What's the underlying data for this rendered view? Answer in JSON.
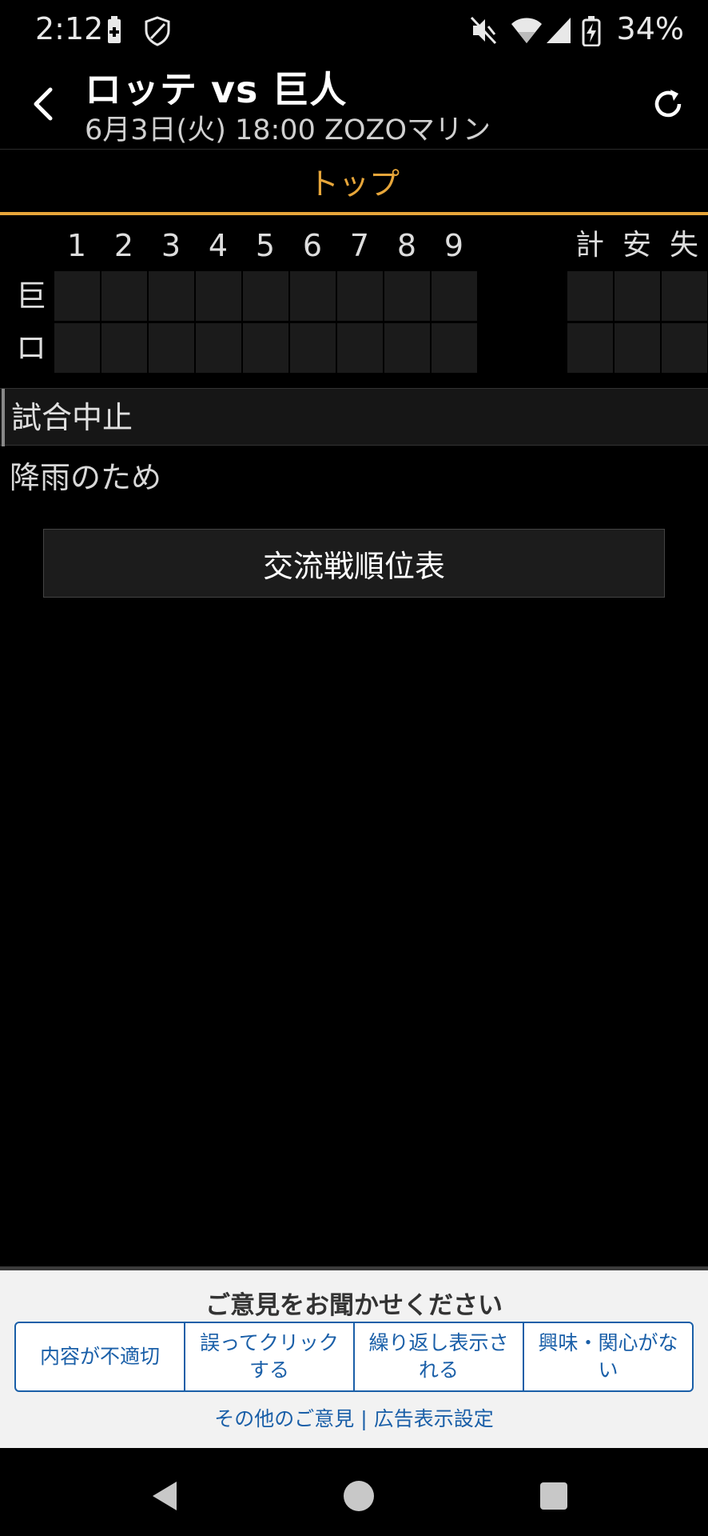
{
  "status_bar": {
    "time": "2:12",
    "battery_percent": "34%",
    "icons": [
      "battery-saver-icon",
      "shield-icon",
      "mute-icon",
      "wifi-icon",
      "signal-icon",
      "battery-charging-icon"
    ]
  },
  "header": {
    "title": "ロッテ vs 巨人",
    "subtitle": "6月3日(火) 18:00 ZOZOマリン",
    "back_icon": "back-arrow-icon",
    "refresh_icon": "refresh-icon"
  },
  "tabs": [
    {
      "label": "トップ",
      "active": true,
      "color": "#e7a63a"
    }
  ],
  "scoreboard": {
    "innings": [
      "1",
      "2",
      "3",
      "4",
      "5",
      "6",
      "7",
      "8",
      "9"
    ],
    "totals": [
      "計",
      "安",
      "失"
    ],
    "teams": [
      {
        "label": "巨",
        "innings": [
          "",
          "",
          "",
          "",
          "",
          "",
          "",
          "",
          ""
        ],
        "totals": [
          "",
          "",
          ""
        ]
      },
      {
        "label": "ロ",
        "innings": [
          "",
          "",
          "",
          "",
          "",
          "",
          "",
          "",
          ""
        ],
        "totals": [
          "",
          "",
          ""
        ]
      }
    ]
  },
  "game_status": {
    "status": "試合中止",
    "reason": "降雨のため"
  },
  "standings_button": "交流戦順位表",
  "feedback": {
    "title": "ご意見をお聞かせください",
    "options": [
      "内容が不適切",
      "誤ってクリックする",
      "繰り返し表示される",
      "興味・関心がない"
    ],
    "links": [
      "その他のご意見",
      "広告表示設定"
    ],
    "separator": "|",
    "accent_color": "#1a5fa8"
  },
  "nav": {
    "icons": [
      "nav-back-icon",
      "nav-home-icon",
      "nav-recents-icon"
    ]
  }
}
